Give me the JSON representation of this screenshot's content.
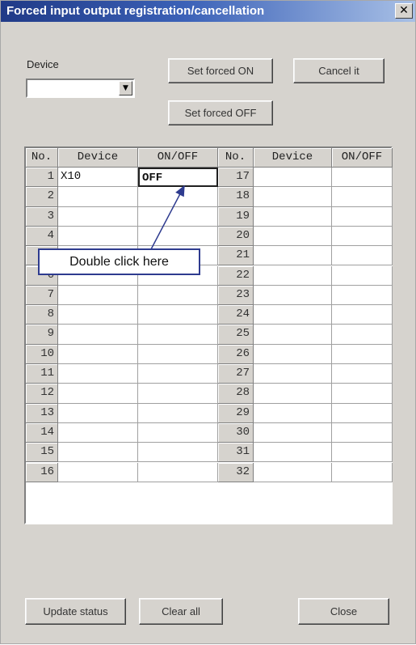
{
  "window": {
    "title": "Forced input output registration/cancellation",
    "close_glyph": "✕"
  },
  "device_select": {
    "label": "Device",
    "value": "",
    "arrow_glyph": "▼"
  },
  "buttons": {
    "set_forced_on": "Set forced ON",
    "cancel_it": "Cancel it",
    "set_forced_off": "Set forced OFF",
    "update_status": "Update status",
    "clear_all": "Clear all",
    "close": "Close"
  },
  "table": {
    "headers": [
      "No.",
      "Device",
      "ON/OFF",
      "No.",
      "Device",
      "ON/OFF"
    ],
    "rows": [
      {
        "no": "1",
        "device": "X10",
        "state": "OFF",
        "no2": "17",
        "device2": "",
        "state2": ""
      },
      {
        "no": "2",
        "device": "",
        "state": "",
        "no2": "18",
        "device2": "",
        "state2": ""
      },
      {
        "no": "3",
        "device": "",
        "state": "",
        "no2": "19",
        "device2": "",
        "state2": ""
      },
      {
        "no": "4",
        "device": "",
        "state": "",
        "no2": "20",
        "device2": "",
        "state2": ""
      },
      {
        "no": "5",
        "device": "",
        "state": "",
        "no2": "21",
        "device2": "",
        "state2": ""
      },
      {
        "no": "6",
        "device": "",
        "state": "",
        "no2": "22",
        "device2": "",
        "state2": ""
      },
      {
        "no": "7",
        "device": "",
        "state": "",
        "no2": "23",
        "device2": "",
        "state2": ""
      },
      {
        "no": "8",
        "device": "",
        "state": "",
        "no2": "24",
        "device2": "",
        "state2": ""
      },
      {
        "no": "9",
        "device": "",
        "state": "",
        "no2": "25",
        "device2": "",
        "state2": ""
      },
      {
        "no": "10",
        "device": "",
        "state": "",
        "no2": "26",
        "device2": "",
        "state2": ""
      },
      {
        "no": "11",
        "device": "",
        "state": "",
        "no2": "27",
        "device2": "",
        "state2": ""
      },
      {
        "no": "12",
        "device": "",
        "state": "",
        "no2": "28",
        "device2": "",
        "state2": ""
      },
      {
        "no": "13",
        "device": "",
        "state": "",
        "no2": "29",
        "device2": "",
        "state2": ""
      },
      {
        "no": "14",
        "device": "",
        "state": "",
        "no2": "30",
        "device2": "",
        "state2": ""
      },
      {
        "no": "15",
        "device": "",
        "state": "",
        "no2": "31",
        "device2": "",
        "state2": ""
      },
      {
        "no": "16",
        "device": "",
        "state": "",
        "no2": "32",
        "device2": "",
        "state2": ""
      }
    ]
  },
  "annotation": {
    "text": "Double click here",
    "color": "#2e3b8f"
  }
}
